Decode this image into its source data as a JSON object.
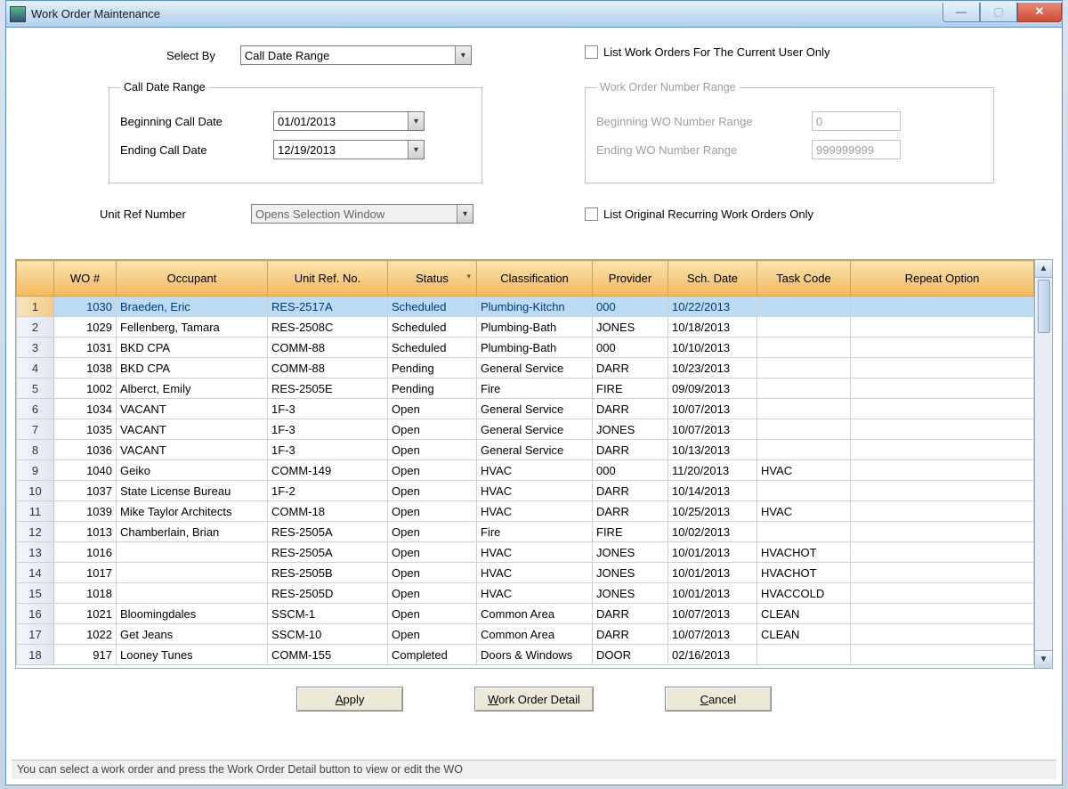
{
  "window": {
    "title": "Work Order Maintenance"
  },
  "filters": {
    "select_by": {
      "label": "Select By",
      "value": "Call Date Range"
    },
    "list_current_user": {
      "label": "List Work Orders For The Current User Only",
      "checked": false
    },
    "call_date_range": {
      "legend": "Call Date Range",
      "begin_label": "Beginning Call Date",
      "begin_value": "01/01/2013",
      "end_label": "Ending Call Date",
      "end_value": "12/19/2013"
    },
    "wo_number_range": {
      "legend": "Work Order Number Range",
      "begin_label": "Beginning WO Number Range",
      "begin_value": "0",
      "end_label": "Ending WO Number Range",
      "end_value": "999999999"
    },
    "unit_ref": {
      "label": "Unit Ref Number",
      "placeholder": "Opens Selection Window"
    },
    "list_recurring": {
      "label": "List Original Recurring Work Orders Only",
      "checked": false
    }
  },
  "grid": {
    "columns": [
      "WO #",
      "Occupant",
      "Unit Ref. No.",
      "Status",
      "Classification",
      "Provider",
      "Sch. Date",
      "Task Code",
      "Repeat Option"
    ],
    "sort_col_index": 3,
    "selected_row": 0,
    "rows": [
      {
        "wo": "1030",
        "occ": "Braeden, Eric",
        "unit": "RES-2517A",
        "status": "Scheduled",
        "class": "Plumbing-Kitchn",
        "prov": "000",
        "date": "10/22/2013",
        "task": "",
        "repeat": ""
      },
      {
        "wo": "1029",
        "occ": "Fellenberg, Tamara",
        "unit": "RES-2508C",
        "status": "Scheduled",
        "class": "Plumbing-Bath",
        "prov": "JONES",
        "date": "10/18/2013",
        "task": "",
        "repeat": ""
      },
      {
        "wo": "1031",
        "occ": "BKD CPA",
        "unit": "COMM-88",
        "status": "Scheduled",
        "class": "Plumbing-Bath",
        "prov": "000",
        "date": "10/10/2013",
        "task": "",
        "repeat": ""
      },
      {
        "wo": "1038",
        "occ": "BKD CPA",
        "unit": "COMM-88",
        "status": "Pending",
        "class": "General Service",
        "prov": "DARR",
        "date": "10/23/2013",
        "task": "",
        "repeat": ""
      },
      {
        "wo": "1002",
        "occ": "Alberct, Emily",
        "unit": "RES-2505E",
        "status": "Pending",
        "class": "Fire",
        "prov": "FIRE",
        "date": "09/09/2013",
        "task": "",
        "repeat": ""
      },
      {
        "wo": "1034",
        "occ": "VACANT",
        "unit": "1F-3",
        "status": "Open",
        "class": "General Service",
        "prov": "DARR",
        "date": "10/07/2013",
        "task": "",
        "repeat": ""
      },
      {
        "wo": "1035",
        "occ": "VACANT",
        "unit": "1F-3",
        "status": "Open",
        "class": "General Service",
        "prov": "JONES",
        "date": "10/07/2013",
        "task": "",
        "repeat": ""
      },
      {
        "wo": "1036",
        "occ": "VACANT",
        "unit": "1F-3",
        "status": "Open",
        "class": "General Service",
        "prov": "DARR",
        "date": "10/13/2013",
        "task": "",
        "repeat": ""
      },
      {
        "wo": "1040",
        "occ": "Geiko",
        "unit": "COMM-149",
        "status": "Open",
        "class": "HVAC",
        "prov": "000",
        "date": "11/20/2013",
        "task": "HVAC",
        "repeat": ""
      },
      {
        "wo": "1037",
        "occ": "State License Bureau",
        "unit": "1F-2",
        "status": "Open",
        "class": "HVAC",
        "prov": "DARR",
        "date": "10/14/2013",
        "task": "",
        "repeat": ""
      },
      {
        "wo": "1039",
        "occ": "Mike Taylor Architects",
        "unit": "COMM-18",
        "status": "Open",
        "class": "HVAC",
        "prov": "DARR",
        "date": "10/25/2013",
        "task": "HVAC",
        "repeat": ""
      },
      {
        "wo": "1013",
        "occ": "Chamberlain, Brian",
        "unit": "RES-2505A",
        "status": "Open",
        "class": "Fire",
        "prov": "FIRE",
        "date": "10/02/2013",
        "task": "",
        "repeat": ""
      },
      {
        "wo": "1016",
        "occ": "",
        "unit": "RES-2505A",
        "status": "Open",
        "class": "HVAC",
        "prov": "JONES",
        "date": "10/01/2013",
        "task": "HVACHOT",
        "repeat": ""
      },
      {
        "wo": "1017",
        "occ": "",
        "unit": "RES-2505B",
        "status": "Open",
        "class": "HVAC",
        "prov": "JONES",
        "date": "10/01/2013",
        "task": "HVACHOT",
        "repeat": ""
      },
      {
        "wo": "1018",
        "occ": "",
        "unit": "RES-2505D",
        "status": "Open",
        "class": "HVAC",
        "prov": "JONES",
        "date": "10/01/2013",
        "task": "HVACCOLD",
        "repeat": ""
      },
      {
        "wo": "1021",
        "occ": "Bloomingdales",
        "unit": "SSCM-1",
        "status": "Open",
        "class": "Common Area",
        "prov": "DARR",
        "date": "10/07/2013",
        "task": "CLEAN",
        "repeat": ""
      },
      {
        "wo": "1022",
        "occ": "Get Jeans",
        "unit": "SSCM-10",
        "status": "Open",
        "class": "Common Area",
        "prov": "DARR",
        "date": "10/07/2013",
        "task": "CLEAN",
        "repeat": ""
      },
      {
        "wo": "917",
        "occ": "Looney Tunes",
        "unit": "COMM-155",
        "status": "Completed",
        "class": "Doors & Windows",
        "prov": "DOOR",
        "date": "02/16/2013",
        "task": "",
        "repeat": ""
      }
    ]
  },
  "buttons": {
    "apply": "Apply",
    "detail": "Work Order Detail",
    "cancel": "Cancel"
  },
  "status_text": "You can select a work order and press the Work Order Detail button to view or edit the WO"
}
